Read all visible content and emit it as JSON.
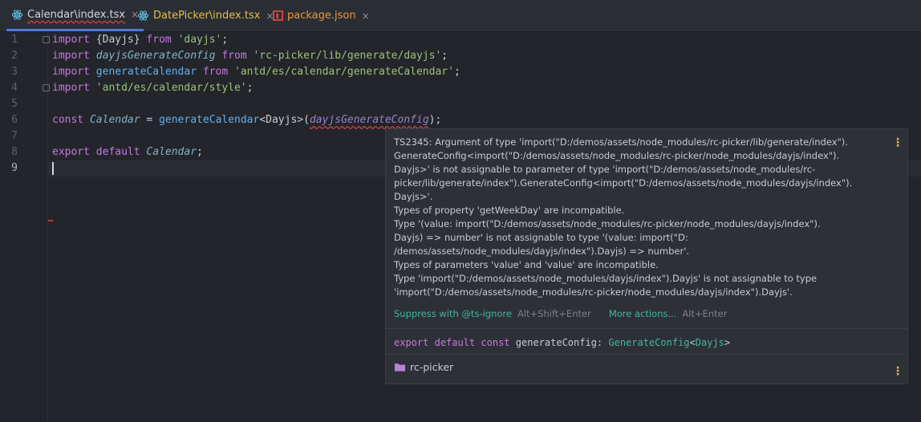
{
  "tabs": [
    {
      "label": "Calendar\\index.tsx",
      "icon": "react-icon",
      "active": true
    },
    {
      "label": "DatePicker\\index.tsx",
      "icon": "react-icon",
      "active": false
    },
    {
      "label": "package.json",
      "icon": "npm-icon",
      "active": false
    }
  ],
  "tab_close": "×",
  "gutter": {
    "lines": [
      "1",
      "2",
      "3",
      "4",
      "5",
      "6",
      "7",
      "8",
      "9"
    ]
  },
  "code": {
    "l1": {
      "kw": "import",
      "a": " {Dayjs} ",
      "kw2": "from",
      "b": " ",
      "str": "'dayjs'",
      "end": ";"
    },
    "l2": {
      "kw": "import",
      "a": " ",
      "id": "dayjsGenerateConfig",
      "b": " ",
      "kw2": "from",
      "c": " ",
      "str": "'rc-picker/lib/generate/dayjs'",
      "end": ";"
    },
    "l3": {
      "kw": "import",
      "a": " ",
      "id": "generateCalendar",
      "b": " ",
      "kw2": "from",
      "c": " ",
      "str": "'antd/es/calendar/generateCalendar'",
      "end": ";"
    },
    "l4": {
      "kw": "import",
      "a": " ",
      "str": "'antd/es/calendar/style'",
      "end": ";"
    },
    "l6": {
      "kw": "const",
      "a": " ",
      "id": "Calendar",
      "b": " = ",
      "fn": "generateCalendar",
      "c": "<Dayjs>(",
      "param": "dayjsGenerateConfig",
      "end": ");"
    },
    "l8": {
      "kw": "export",
      "a": " ",
      "kw2": "default",
      "b": " ",
      "id": "Calendar",
      "end": ";"
    }
  },
  "popup": {
    "message_lines": [
      "TS2345: Argument of type 'import(\"D:/demos/assets/node_modules/rc-picker/lib/generate/index\").",
      "GenerateConfig<import(\"D:/demos/assets/node_modules/rc-picker/node_modules/dayjs/index\").",
      "Dayjs>' is not assignable to parameter of type 'import(\"D:/demos/assets/node_modules/rc-",
      "picker/lib/generate/index\").GenerateConfig<import(\"D:/demos/assets/node_modules/dayjs/index\").",
      "Dayjs>'.",
      "   Types of property 'getWeekDay' are incompatible.",
      "      Type '(value: import(\"D:/demos/assets/node_modules/rc-picker/node_modules/dayjs/index\").",
      "Dayjs) => number' is not assignable to type '(value: import(\"D:",
      "/demos/assets/node_modules/dayjs/index\").Dayjs) => number'.",
      "         Types of parameters 'value' and 'value' are incompatible.",
      "            Type 'import(\"D:/demos/assets/node_modules/dayjs/index\").Dayjs' is not assignable to type",
      "'import(\"D:/demos/assets/node_modules/rc-picker/node_modules/dayjs/index\").Dayjs'."
    ],
    "suppress_label": "Suppress with @ts-ignore",
    "suppress_shortcut": "Alt+Shift+Enter",
    "more_label": "More actions...",
    "more_shortcut": "Alt+Enter",
    "signature": {
      "kw1": "export",
      "kw2": "default",
      "kw3": "const",
      "name": "generateConfig",
      "colon": ": ",
      "type": "GenerateConfig",
      "lt": "<",
      "arg": "Dayjs",
      "gt": ">"
    },
    "package_name": "rc-picker"
  },
  "colors": {
    "accent": "#4d7be0",
    "error": "#d0443a",
    "link": "#3fb7a3"
  }
}
